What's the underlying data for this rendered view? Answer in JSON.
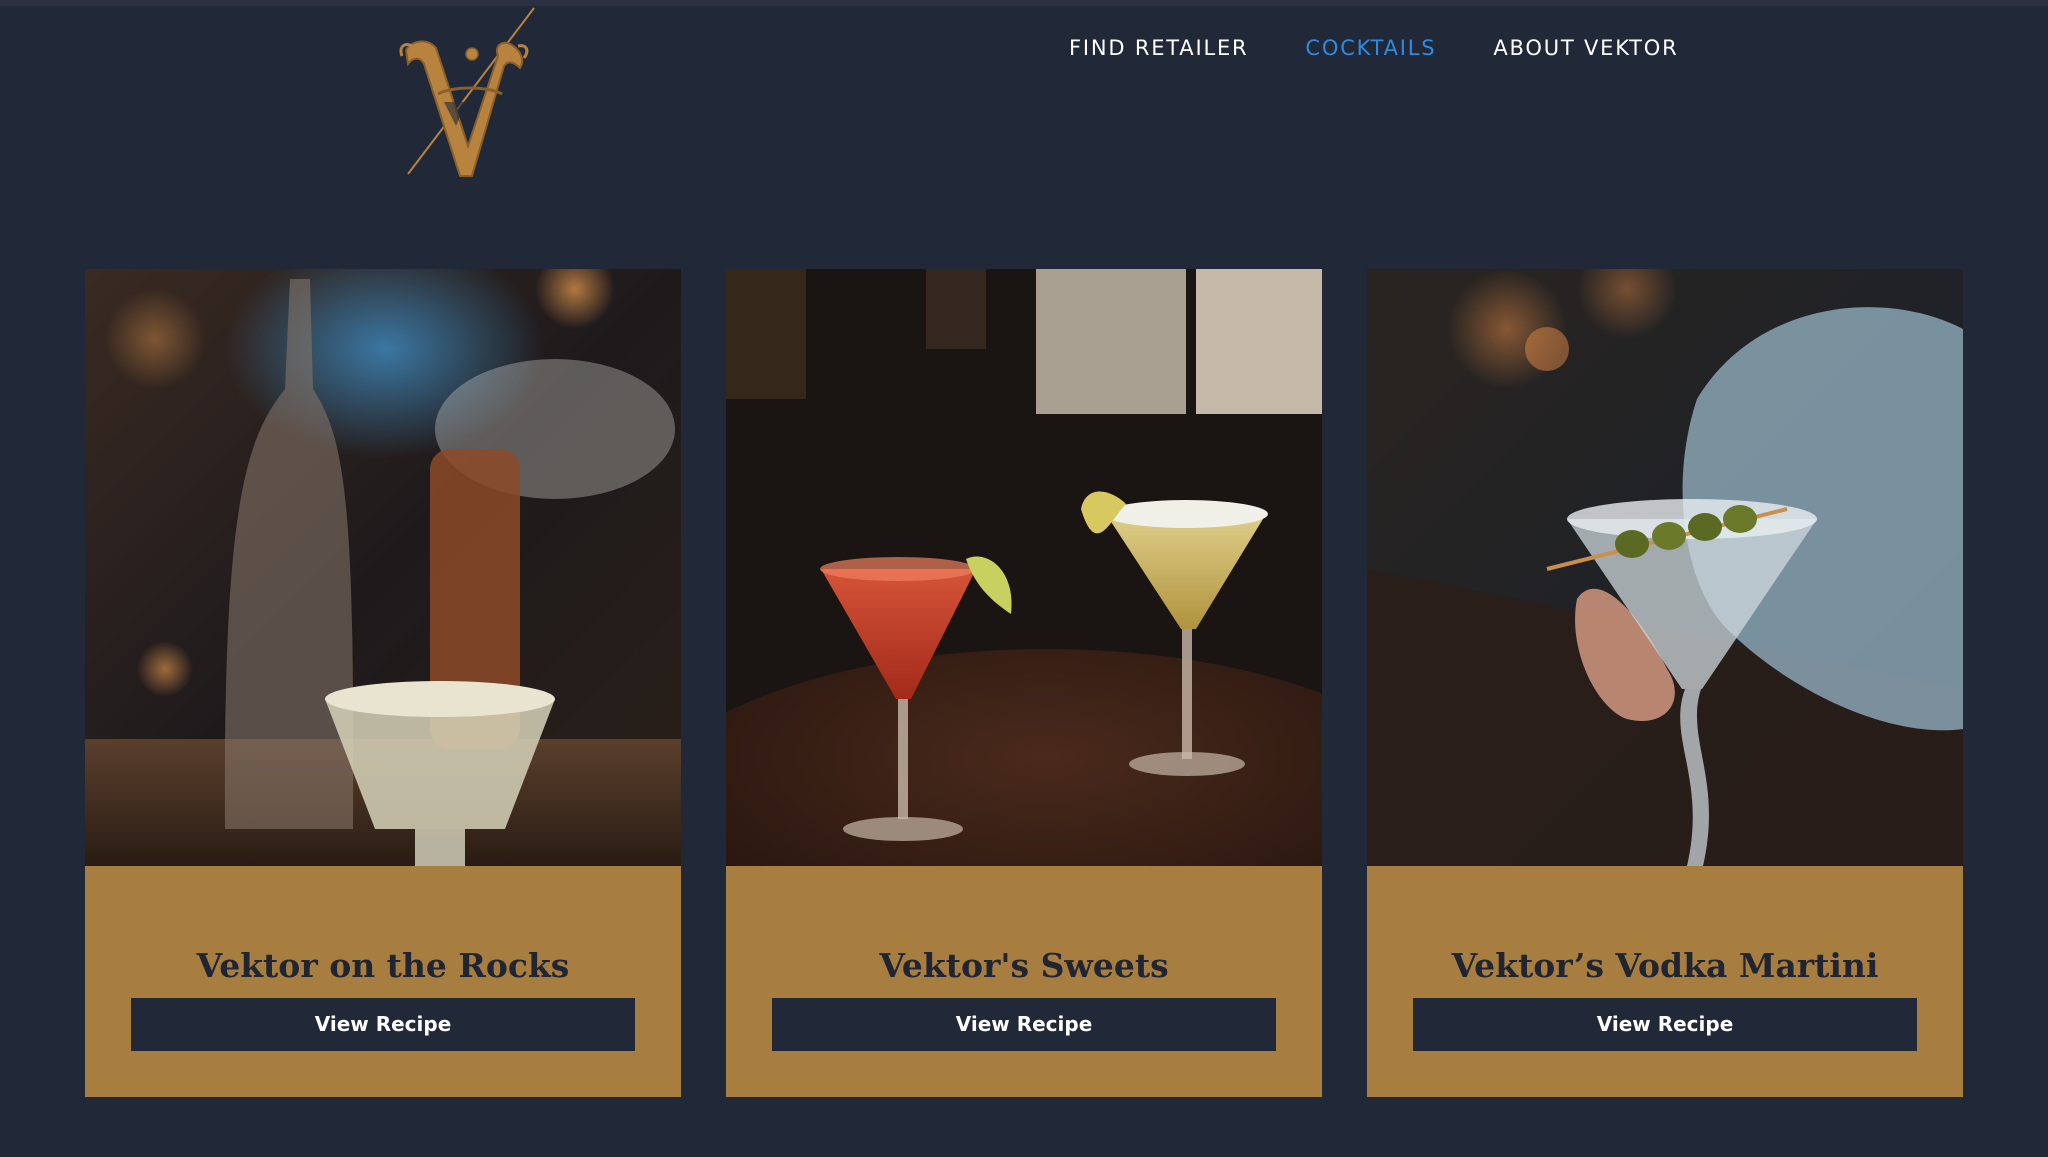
{
  "brand": {
    "logo_icon": "vektor-v-logo-icon",
    "logo_color": "#b8833f"
  },
  "nav": {
    "items": [
      {
        "label": "FIND RETAILER",
        "active": false
      },
      {
        "label": "COCKTAILS",
        "active": true
      },
      {
        "label": "ABOUT VEKTOR",
        "active": false
      }
    ]
  },
  "cards": [
    {
      "title": "Vektor on the Rocks",
      "button_label": "View Recipe",
      "image": "cocktail-on-the-rocks-photo"
    },
    {
      "title": "Vektor's Sweets",
      "button_label": "View Recipe",
      "image": "two-martini-glasses-photo"
    },
    {
      "title": "Vektor’s Vodka Martini",
      "button_label": "View Recipe",
      "image": "vodka-martini-with-olives-photo"
    }
  ],
  "colors": {
    "background": "#212838",
    "card": "#a87d40",
    "button": "#212838",
    "nav_active": "#2f8ae0",
    "nav_text": "#ffffff"
  }
}
